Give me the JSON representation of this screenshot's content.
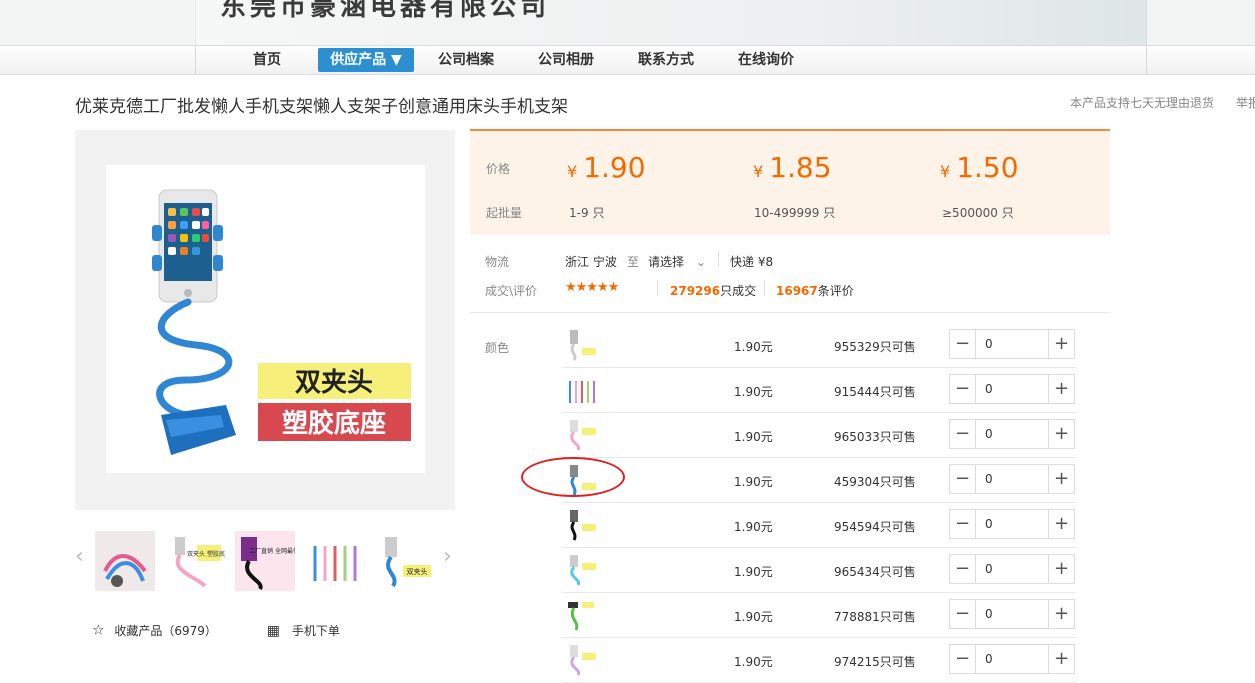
{
  "header": {
    "company_name": "东莞市豪涵电器有限公司"
  },
  "nav": {
    "items": [
      {
        "label": "首页"
      },
      {
        "label": "供应产品 ▼"
      },
      {
        "label": "公司档案"
      },
      {
        "label": "公司相册"
      },
      {
        "label": "联系方式"
      },
      {
        "label": "在线询价"
      }
    ],
    "active_color": "#2b8fd0"
  },
  "product": {
    "title": "优莱克德工厂批发懒人手机支架懒人支架子创意通用床头手机支架",
    "return_policy": "本产品支持七天无理由退货",
    "report_text": "举报",
    "main_image": {
      "badge_top": "双夹头",
      "badge_bottom": "塑胶底座"
    }
  },
  "gallery": {
    "thumb_texts": [
      "",
      "双夹头 塑胶底座",
      "工厂直销 全网最低价",
      "",
      "双夹头"
    ]
  },
  "utility": {
    "favorite_label": "收藏产品（6979）",
    "mobile_order_label": "手机下单"
  },
  "pricing": {
    "price_label": "价格",
    "moq_label": "起批量",
    "currency": "¥",
    "tiers": [
      {
        "price": "1.90",
        "range": "1-9",
        "unit": "只"
      },
      {
        "price": "1.85",
        "range": "10-499999",
        "unit": "只"
      },
      {
        "price": "1.50",
        "range": "≥500000",
        "unit": "只"
      }
    ],
    "accent": "#f26a00"
  },
  "logistics": {
    "label": "物流",
    "origin": "浙江 宁波",
    "to": "至",
    "destination_select": "请选择",
    "shipping": "快递 ¥8"
  },
  "deals": {
    "label": "成交\\评价",
    "rating_stars": 4.5,
    "stars_text": "★★★★★",
    "sold_count": "279296",
    "sold_suffix": "只成交",
    "review_count": "16967",
    "review_suffix": "条评价"
  },
  "sku": {
    "label": "颜色",
    "rows": [
      {
        "price": "1.90元",
        "stock": "955329只可售",
        "qty": "0"
      },
      {
        "price": "1.90元",
        "stock": "915444只可售",
        "qty": "0"
      },
      {
        "price": "1.90元",
        "stock": "965033只可售",
        "qty": "0"
      },
      {
        "price": "1.90元",
        "stock": "459304只可售",
        "qty": "0"
      },
      {
        "price": "1.90元",
        "stock": "954594只可售",
        "qty": "0"
      },
      {
        "price": "1.90元",
        "stock": "965434只可售",
        "qty": "0"
      },
      {
        "price": "1.90元",
        "stock": "778881只可售",
        "qty": "0"
      },
      {
        "price": "1.90元",
        "stock": "974215只可售",
        "qty": "0"
      }
    ]
  }
}
